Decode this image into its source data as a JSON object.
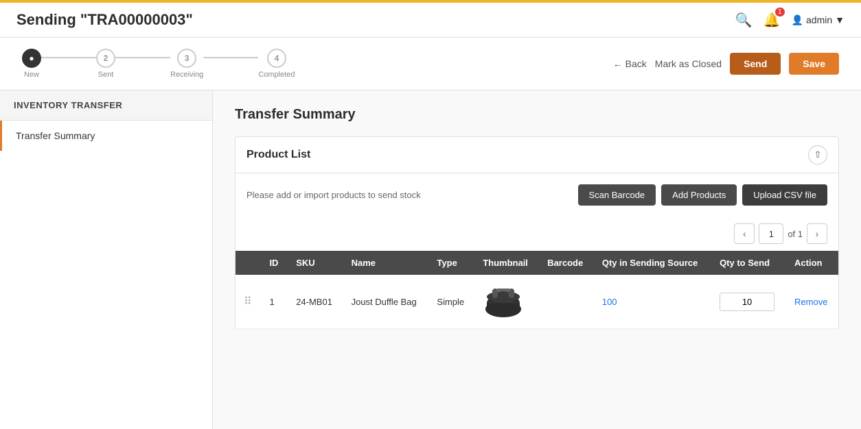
{
  "topBar": {},
  "header": {
    "title": "Sending \"TRA00000003\"",
    "adminLabel": "admin",
    "icons": {
      "search": "🔍",
      "bell": "🔔",
      "user": "👤",
      "notifCount": "1"
    }
  },
  "wizard": {
    "steps": [
      {
        "num": "1",
        "label": "New",
        "active": true
      },
      {
        "num": "2",
        "label": "Sent",
        "active": false
      },
      {
        "num": "3",
        "label": "Receiving",
        "active": false
      },
      {
        "num": "4",
        "label": "Completed",
        "active": false
      }
    ],
    "actions": {
      "back": "Back",
      "markClosed": "Mark as Closed",
      "send": "Send",
      "save": "Save"
    }
  },
  "sidebar": {
    "heading": "INVENTORY TRANSFER",
    "items": [
      {
        "label": "Transfer Summary"
      }
    ]
  },
  "main": {
    "sectionTitle": "Transfer Summary",
    "productList": {
      "label": "Product List",
      "emptyText": "Please add or import products to send stock",
      "buttons": {
        "scanBarcode": "Scan Barcode",
        "addProducts": "Add Products",
        "uploadCSV": "Upload CSV file"
      }
    },
    "pagination": {
      "currentPage": "1",
      "ofLabel": "of 1"
    },
    "table": {
      "columns": [
        "",
        "ID",
        "SKU",
        "Name",
        "Type",
        "Thumbnail",
        "Barcode",
        "Qty in Sending Source",
        "Qty to Send",
        "Action"
      ],
      "rows": [
        {
          "drag": "⠿",
          "id": "1",
          "sku": "24-MB01",
          "name": "Joust Duffle Bag",
          "type": "Simple",
          "thumbnail": "bag",
          "barcode": "",
          "qtySendingSource": "100",
          "qtyToSend": "10",
          "action": "Remove"
        }
      ]
    }
  }
}
